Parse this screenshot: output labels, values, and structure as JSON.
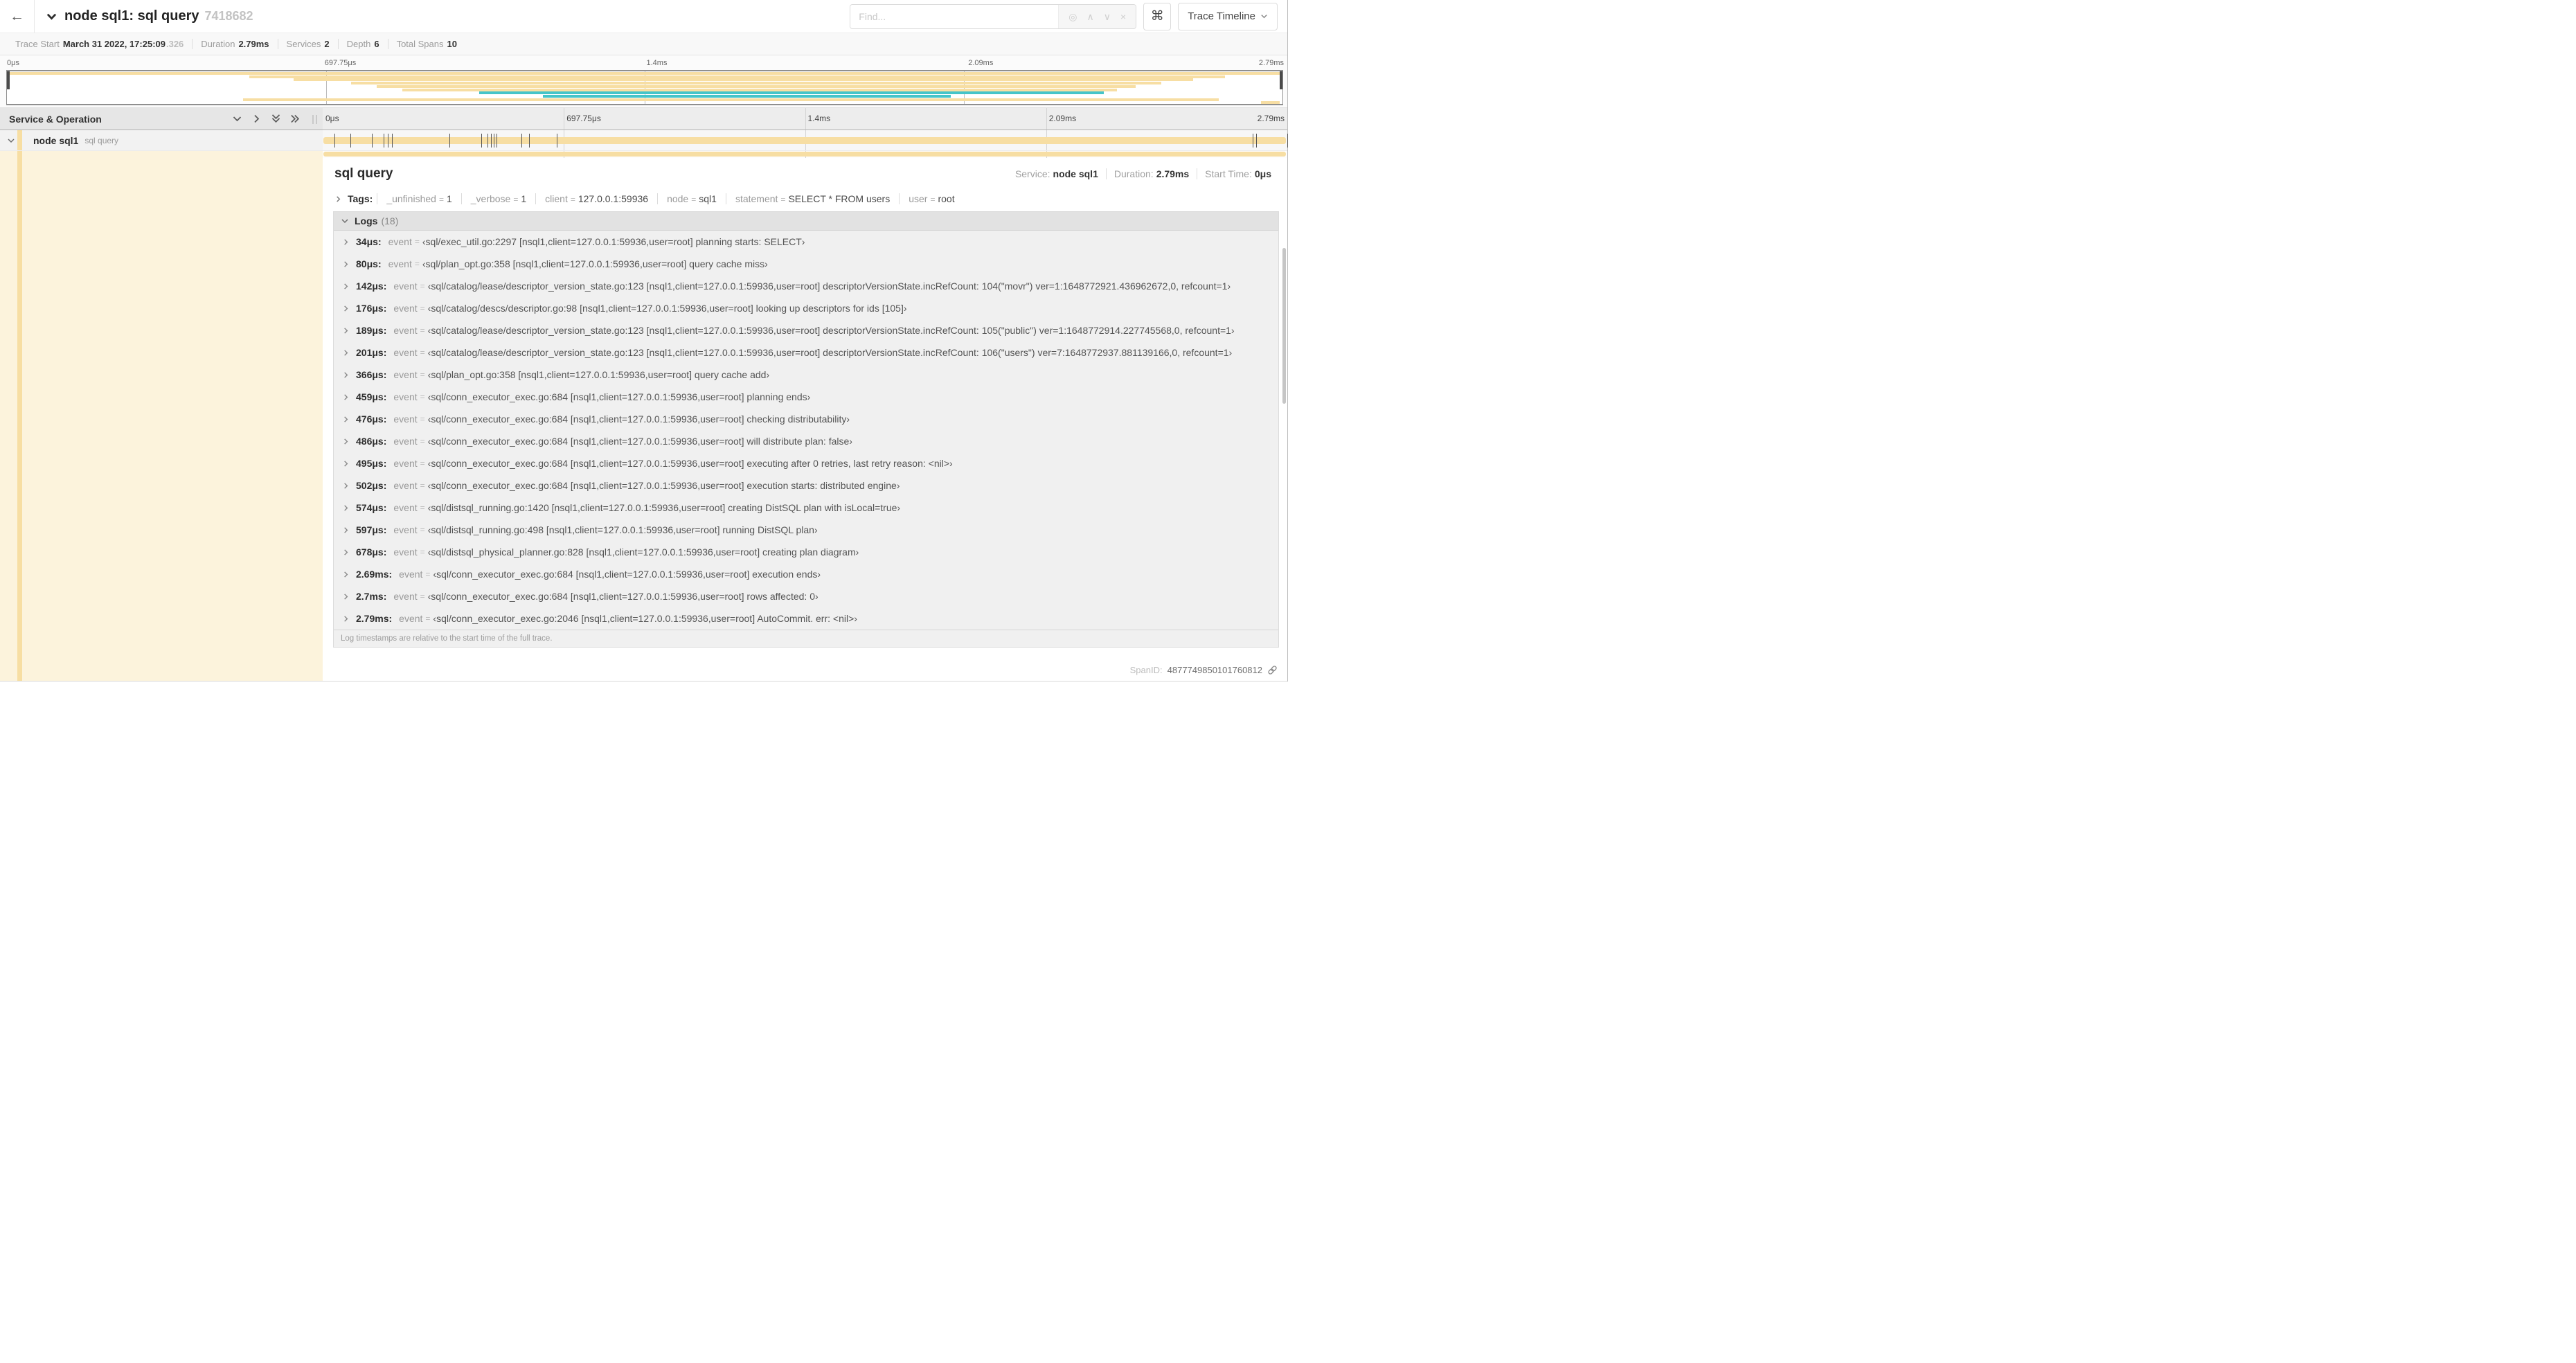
{
  "trace": {
    "duration_us": 2790
  },
  "header": {
    "back_icon": "←",
    "title": "node sql1: sql query",
    "trace_id": "7418682",
    "find_placeholder": "Find...",
    "locate_icon": "◎",
    "prev_icon": "∧",
    "next_icon": "∨",
    "clear_icon": "×",
    "shortcut_key": "⌘",
    "view_dropdown_label": "Trace Timeline"
  },
  "summary": {
    "items": [
      {
        "label": "Trace Start",
        "value": "March 31 2022, 17:25:09",
        "fraction": ".326"
      },
      {
        "label": "Duration",
        "value": "2.79ms",
        "fraction": ""
      },
      {
        "label": "Services",
        "value": "2",
        "fraction": ""
      },
      {
        "label": "Depth",
        "value": "6",
        "fraction": ""
      },
      {
        "label": "Total Spans",
        "value": "10",
        "fraction": ""
      }
    ]
  },
  "timeline": {
    "axis_ticks": [
      "0μs",
      "697.75μs",
      "1.4ms",
      "2.09ms",
      "2.79ms"
    ],
    "left_header": "Service & Operation",
    "row": {
      "service": "node sql1",
      "operation": "sql query"
    }
  },
  "minimap": {
    "spans": [
      {
        "start": 0,
        "end": 100,
        "color": "tan"
      },
      {
        "start": 19,
        "end": 95.5,
        "color": "tan"
      },
      {
        "start": 22.5,
        "end": 93,
        "color": "tan"
      },
      {
        "start": 27,
        "end": 90.5,
        "color": "tan"
      },
      {
        "start": 29,
        "end": 88.5,
        "color": "tan"
      },
      {
        "start": 31,
        "end": 87,
        "color": "tan"
      },
      {
        "start": 37,
        "end": 86,
        "color": "teal"
      },
      {
        "start": 42,
        "end": 74,
        "color": "teal"
      },
      {
        "start": 18.5,
        "end": 95,
        "color": "tan"
      },
      {
        "start": 98.3,
        "end": 99.8,
        "color": "tan"
      }
    ]
  },
  "detail": {
    "operation": "sql query",
    "meta": [
      {
        "label": "Service:",
        "value": "node sql1"
      },
      {
        "label": "Duration:",
        "value": "2.79ms"
      },
      {
        "label": "Start Time:",
        "value": "0μs"
      }
    ],
    "tags_label": "Tags:",
    "tags": [
      {
        "key": "_unfinished",
        "value": "1"
      },
      {
        "key": "_verbose",
        "value": "1"
      },
      {
        "key": "client",
        "value": "127.0.0.1:59936"
      },
      {
        "key": "node",
        "value": "sql1"
      },
      {
        "key": "statement",
        "value": "SELECT * FROM users"
      },
      {
        "key": "user",
        "value": "root"
      }
    ],
    "logs_label": "Logs",
    "logs_count": "(18)",
    "logs": [
      {
        "t": "34μs",
        "t_us": 34,
        "field": "event",
        "value": "‹sql/exec_util.go:2297 [nsql1,client=127.0.0.1:59936,user=root] planning starts: SELECT›"
      },
      {
        "t": "80μs",
        "t_us": 80,
        "field": "event",
        "value": "‹sql/plan_opt.go:358 [nsql1,client=127.0.0.1:59936,user=root] query cache miss›"
      },
      {
        "t": "142μs",
        "t_us": 142,
        "field": "event",
        "value": "‹sql/catalog/lease/descriptor_version_state.go:123 [nsql1,client=127.0.0.1:59936,user=root] descriptorVersionState.incRefCount: 104(\"movr\") ver=1:1648772921.436962672,0, refcount=1›"
      },
      {
        "t": "176μs",
        "t_us": 176,
        "field": "event",
        "value": "‹sql/catalog/descs/descriptor.go:98 [nsql1,client=127.0.0.1:59936,user=root] looking up descriptors for ids [105]›"
      },
      {
        "t": "189μs",
        "t_us": 189,
        "field": "event",
        "value": "‹sql/catalog/lease/descriptor_version_state.go:123 [nsql1,client=127.0.0.1:59936,user=root] descriptorVersionState.incRefCount: 105(\"public\") ver=1:1648772914.227745568,0, refcount=1›"
      },
      {
        "t": "201μs",
        "t_us": 201,
        "field": "event",
        "value": "‹sql/catalog/lease/descriptor_version_state.go:123 [nsql1,client=127.0.0.1:59936,user=root] descriptorVersionState.incRefCount: 106(\"users\") ver=7:1648772937.881139166,0, refcount=1›"
      },
      {
        "t": "366μs",
        "t_us": 366,
        "field": "event",
        "value": "‹sql/plan_opt.go:358 [nsql1,client=127.0.0.1:59936,user=root] query cache add›"
      },
      {
        "t": "459μs",
        "t_us": 459,
        "field": "event",
        "value": "‹sql/conn_executor_exec.go:684 [nsql1,client=127.0.0.1:59936,user=root] planning ends›"
      },
      {
        "t": "476μs",
        "t_us": 476,
        "field": "event",
        "value": "‹sql/conn_executor_exec.go:684 [nsql1,client=127.0.0.1:59936,user=root] checking distributability›"
      },
      {
        "t": "486μs",
        "t_us": 486,
        "field": "event",
        "value": "‹sql/conn_executor_exec.go:684 [nsql1,client=127.0.0.1:59936,user=root] will distribute plan: false›"
      },
      {
        "t": "495μs",
        "t_us": 495,
        "field": "event",
        "value": "‹sql/conn_executor_exec.go:684 [nsql1,client=127.0.0.1:59936,user=root] executing after 0 retries, last retry reason: <nil>›"
      },
      {
        "t": "502μs",
        "t_us": 502,
        "field": "event",
        "value": "‹sql/conn_executor_exec.go:684 [nsql1,client=127.0.0.1:59936,user=root] execution starts: distributed engine›"
      },
      {
        "t": "574μs",
        "t_us": 574,
        "field": "event",
        "value": "‹sql/distsql_running.go:1420 [nsql1,client=127.0.0.1:59936,user=root] creating DistSQL plan with isLocal=true›"
      },
      {
        "t": "597μs",
        "t_us": 597,
        "field": "event",
        "value": "‹sql/distsql_running.go:498 [nsql1,client=127.0.0.1:59936,user=root] running DistSQL plan›"
      },
      {
        "t": "678μs",
        "t_us": 678,
        "field": "event",
        "value": "‹sql/distsql_physical_planner.go:828 [nsql1,client=127.0.0.1:59936,user=root] creating plan diagram›"
      },
      {
        "t": "2.69ms",
        "t_us": 2690,
        "field": "event",
        "value": "‹sql/conn_executor_exec.go:684 [nsql1,client=127.0.0.1:59936,user=root] execution ends›"
      },
      {
        "t": "2.7ms",
        "t_us": 2700,
        "field": "event",
        "value": "‹sql/conn_executor_exec.go:684 [nsql1,client=127.0.0.1:59936,user=root] rows affected: 0›"
      },
      {
        "t": "2.79ms",
        "t_us": 2790,
        "field": "event",
        "value": "‹sql/conn_executor_exec.go:2046 [nsql1,client=127.0.0.1:59936,user=root] AutoCommit. err: <nil>›"
      }
    ],
    "logs_footnote": "Log timestamps are relative to the start time of the full trace.",
    "spanid_label": "SpanID:",
    "spanid": "4877749850101760812"
  },
  "colors": {
    "span_tan": "#F7DEA3",
    "span_tan_light": "#FCF3DC",
    "span_teal": "#45C4C9"
  }
}
